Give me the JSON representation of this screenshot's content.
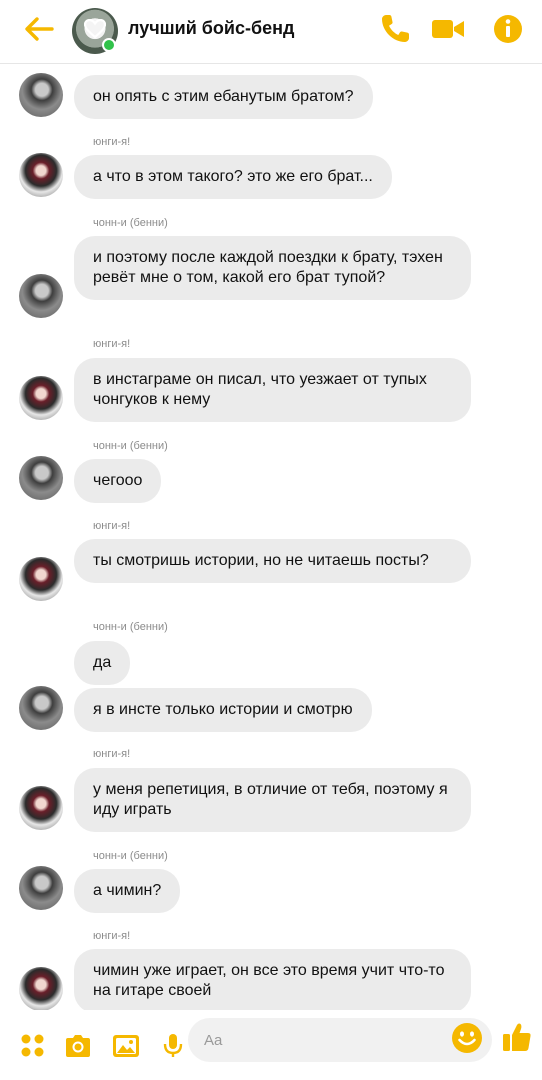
{
  "header": {
    "title": "лучший бойс-бенд",
    "accent": "#f5b800",
    "icons": [
      "back-arrow-icon",
      "phone-icon",
      "video-camera-icon",
      "info-icon"
    ]
  },
  "messages": [
    {
      "type": "bubble",
      "text": "он опять с этим ебанутым братом?"
    },
    {
      "type": "sender",
      "text": "юнги-я!"
    },
    {
      "type": "bubble",
      "text": "а что в этом такого? это же его брат..."
    },
    {
      "type": "sender",
      "text": "чонн-и (бенни)"
    },
    {
      "type": "bubble",
      "text": "и поэтому после каждой поездки к брату, тэхен ревёт мне о том, какой его брат тупой?"
    },
    {
      "type": "sender",
      "text": "юнги-я!"
    },
    {
      "type": "bubble",
      "text": "в инстаграме он писал, что уезжает от тупых чонгуков к нему"
    },
    {
      "type": "sender",
      "text": "чонн-и (бенни)"
    },
    {
      "type": "bubble",
      "text": "чегооо"
    },
    {
      "type": "sender",
      "text": "юнги-я!"
    },
    {
      "type": "bubble",
      "text": "ты смотришь истории, но не читаешь посты?"
    },
    {
      "type": "sender",
      "text": "чонн-и (бенни)"
    },
    {
      "type": "bubble",
      "text": "да"
    },
    {
      "type": "bubble",
      "text": "я в инсте только истории и смотрю"
    },
    {
      "type": "sender",
      "text": "юнги-я!"
    },
    {
      "type": "bubble",
      "text": "у меня репетиция, в отличие от тебя, поэтому я иду играть"
    },
    {
      "type": "sender",
      "text": "чонн-и (бенни)"
    },
    {
      "type": "bubble",
      "text": "а чимин?"
    },
    {
      "type": "sender",
      "text": "юнги-я!"
    },
    {
      "type": "bubble",
      "text": "чимин уже играет, он все это время учит что-то на гитаре своей"
    }
  ],
  "composer": {
    "placeholder": "Aa",
    "icons": [
      "apps-grid-icon",
      "camera-icon",
      "gallery-icon",
      "microphone-icon",
      "emoji-icon",
      "thumbs-up-icon"
    ]
  }
}
